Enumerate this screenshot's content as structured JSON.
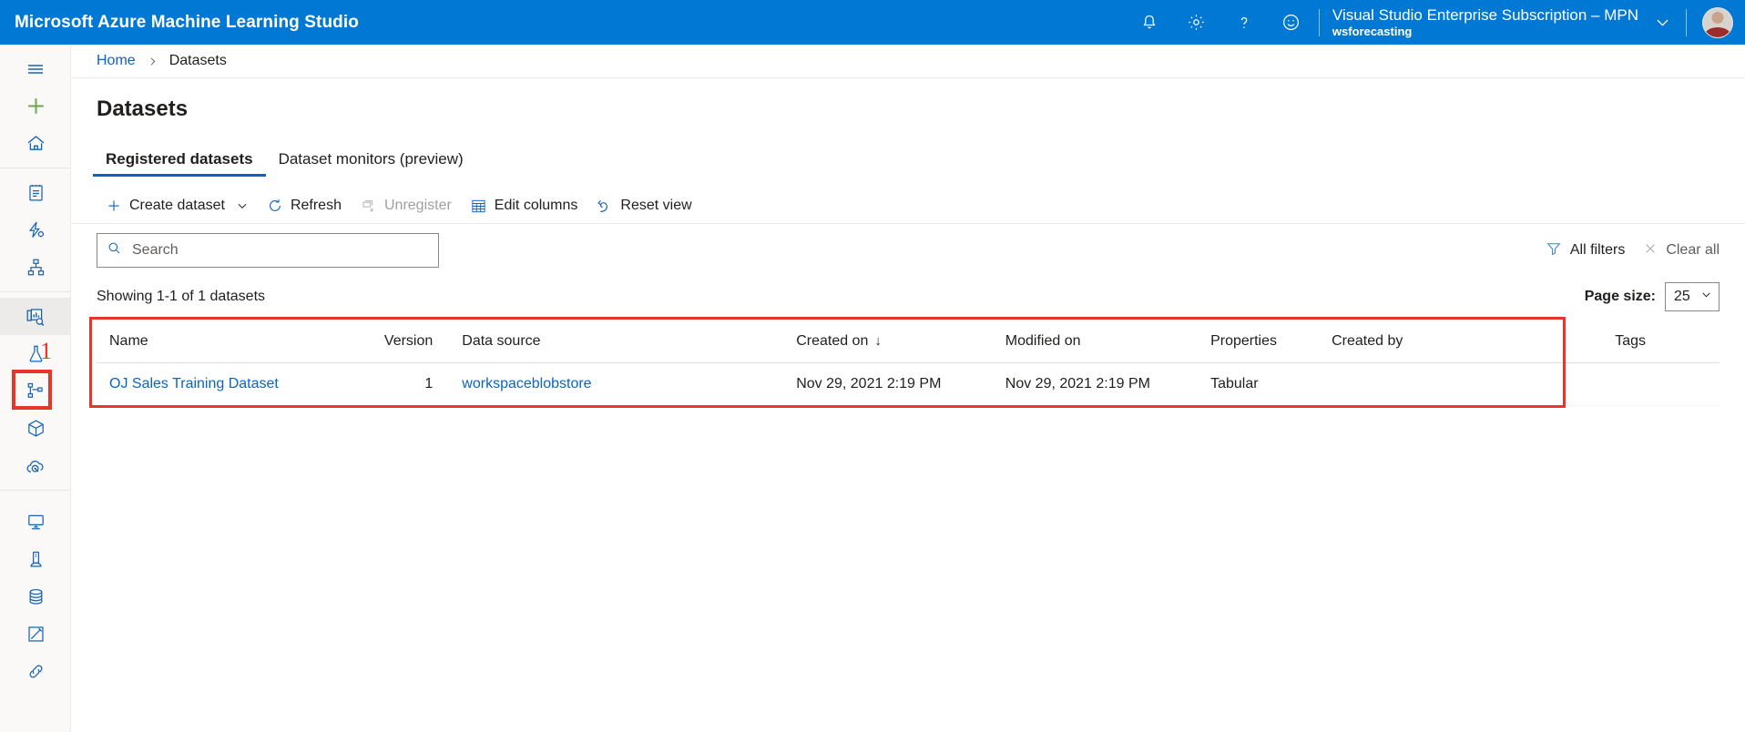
{
  "topbar": {
    "brand": "Microsoft Azure Machine Learning Studio",
    "icons": [
      {
        "name": "notifications-icon",
        "label": "Notifications"
      },
      {
        "name": "settings-gear-icon",
        "label": "Settings"
      },
      {
        "name": "help-question-icon",
        "label": "Help"
      },
      {
        "name": "feedback-smiley-icon",
        "label": "Feedback"
      }
    ],
    "subscription": "Visual Studio Enterprise Subscription – MPN",
    "workspace": "wsforecasting",
    "accent_color": "#0078d4"
  },
  "rail": {
    "groups": [
      {
        "items": [
          {
            "name": "hamburger-menu-icon",
            "label": "Menu",
            "selected": false
          },
          {
            "name": "new-plus-icon",
            "label": "New",
            "selected": false
          },
          {
            "name": "home-icon",
            "label": "Home",
            "selected": false
          }
        ]
      },
      {
        "items": [
          {
            "name": "notebooks-icon",
            "label": "Notebooks",
            "selected": false
          },
          {
            "name": "automated-ml-icon",
            "label": "Automated ML",
            "selected": false
          },
          {
            "name": "designer-icon",
            "label": "Designer",
            "selected": false
          }
        ]
      },
      {
        "items": [
          {
            "name": "datasets-icon",
            "label": "Datasets",
            "selected": true
          },
          {
            "name": "experiments-flask-icon",
            "label": "Experiments",
            "selected": false
          },
          {
            "name": "pipelines-icon",
            "label": "Pipelines",
            "selected": false
          },
          {
            "name": "models-cube-icon",
            "label": "Models",
            "selected": false
          },
          {
            "name": "endpoints-cloud-icon",
            "label": "Endpoints",
            "selected": false
          }
        ]
      },
      {
        "items": [
          {
            "name": "compute-monitor-icon",
            "label": "Compute",
            "selected": false
          },
          {
            "name": "compute-instance-icon",
            "label": "Compute instances",
            "selected": false
          },
          {
            "name": "datastores-icon",
            "label": "Datastores",
            "selected": false
          },
          {
            "name": "data-labeling-icon",
            "label": "Data labeling",
            "selected": false
          },
          {
            "name": "linked-services-icon",
            "label": "Linked Services",
            "selected": false
          }
        ]
      }
    ],
    "annotation_badge": "1",
    "annotation_color": "#e8352a"
  },
  "breadcrumb": {
    "home": "Home",
    "separator": "›",
    "current": "Datasets"
  },
  "page": {
    "title": "Datasets"
  },
  "tabs": [
    {
      "label": "Registered datasets",
      "active": true
    },
    {
      "label": "Dataset monitors (preview)",
      "active": false
    }
  ],
  "toolbar": {
    "create_dataset": "Create dataset",
    "refresh": "Refresh",
    "unregister": "Unregister",
    "edit_columns": "Edit columns",
    "reset_view": "Reset view"
  },
  "search": {
    "placeholder": "Search",
    "value": ""
  },
  "filters": {
    "all_filters": "All filters",
    "clear_all": "Clear all"
  },
  "results": {
    "count_text": "Showing 1-1 of 1 datasets",
    "page_size_label": "Page size:",
    "page_size_value": "25"
  },
  "table": {
    "headers": [
      "Name",
      "Version",
      "Data source",
      "Created on",
      "Modified on",
      "Properties",
      "Created by",
      "Tags"
    ],
    "sort_column": "Created on",
    "sort_arrow": "↓",
    "rows": [
      {
        "name": "OJ Sales Training Dataset",
        "version": "1",
        "data_source": "workspaceblobstore",
        "created_on": "Nov 29, 2021 2:19 PM",
        "modified_on": "Nov 29, 2021 2:19 PM",
        "properties": "Tabular",
        "created_by": "",
        "tags": ""
      }
    ]
  }
}
